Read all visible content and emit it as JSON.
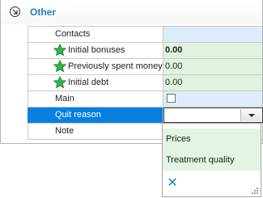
{
  "section": {
    "title": "Other"
  },
  "rows": [
    {
      "label": "Contacts",
      "value": ""
    },
    {
      "label": "Initial bonuses",
      "value": "0.00"
    },
    {
      "label": "Previously spent money",
      "value": "0.00"
    },
    {
      "label": "Initial debt",
      "value": "0.00"
    },
    {
      "label": "Main",
      "value": ""
    },
    {
      "label": "Quit reason",
      "value": ""
    },
    {
      "label": "Note",
      "value": ""
    }
  ],
  "main_checked": false,
  "dropdown": {
    "options": [
      "Prices",
      "Treatment quality"
    ],
    "clear_glyph": "✕"
  },
  "icons": {
    "collapse": "collapse-up-icon",
    "required": "green-star-icon",
    "dropdown": "chevron-down-icon",
    "clear": "close-icon"
  },
  "colors": {
    "title": "#1f7fc6",
    "selected_row": "#0a7fe0",
    "editable_value": "#ddecfb",
    "required_value": "#dff3df",
    "dropdown_option": "#e3f4e3"
  }
}
